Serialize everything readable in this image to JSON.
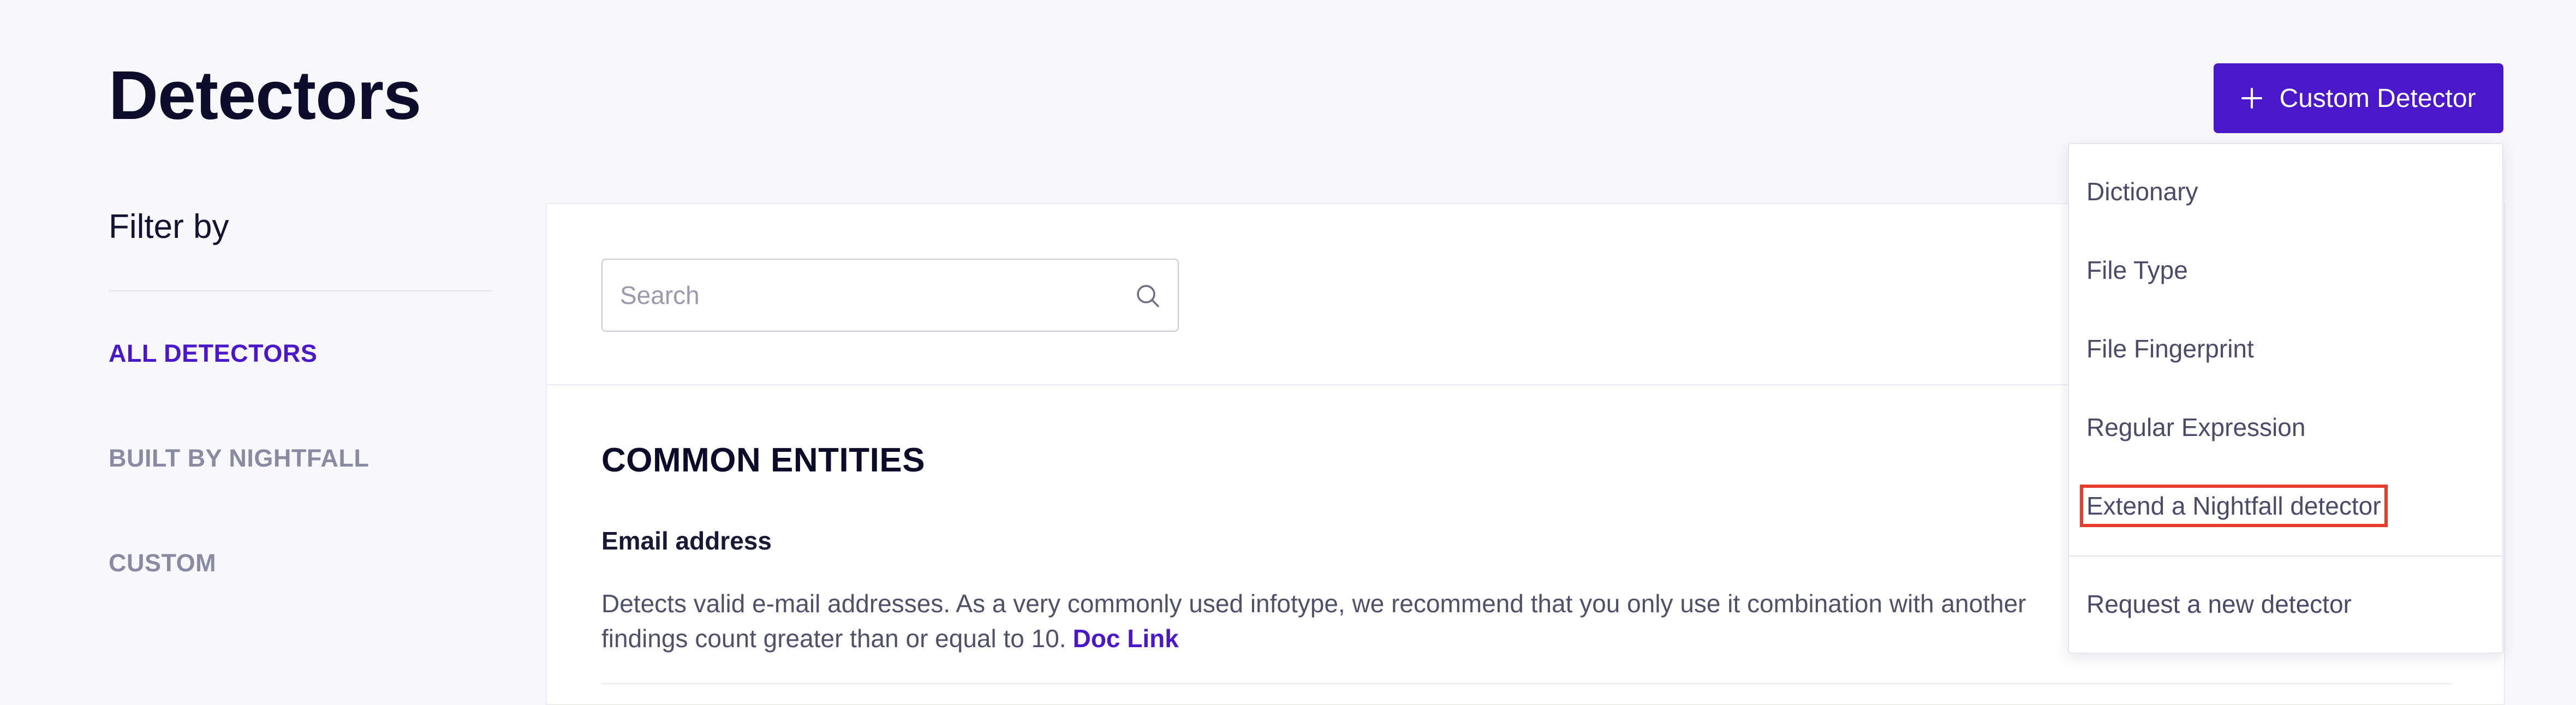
{
  "header": {
    "title": "Detectors",
    "custom_button_label": "Custom Detector"
  },
  "sidebar": {
    "filter_title": "Filter by",
    "items": [
      {
        "label": "ALL DETECTORS",
        "active": true
      },
      {
        "label": "BUILT BY NIGHTFALL",
        "active": false
      },
      {
        "label": "CUSTOM",
        "active": false
      }
    ]
  },
  "search": {
    "placeholder": "Search",
    "value": ""
  },
  "main": {
    "section_title": "COMMON ENTITIES",
    "entity": {
      "name": "Email address",
      "description": "Detects valid e-mail addresses. As a very commonly used infotype, we recommend that you only use it combination with another",
      "description_tail": "findings count greater than or equal to 10.",
      "doc_link": "Doc Link"
    }
  },
  "dropdown": {
    "items": [
      {
        "label": "Dictionary",
        "highlighted": false
      },
      {
        "label": "File Type",
        "highlighted": false
      },
      {
        "label": "File Fingerprint",
        "highlighted": false
      },
      {
        "label": "Regular Expression",
        "highlighted": false
      },
      {
        "label": "Extend a Nightfall detector",
        "highlighted": true
      }
    ],
    "footer_item": "Request a new detector"
  },
  "colors": {
    "accent": "#4a18c9",
    "highlight_border": "#e53d2a",
    "background": "#f8f8fc"
  },
  "icons": {
    "add": "plus-icon",
    "search": "search-icon"
  }
}
